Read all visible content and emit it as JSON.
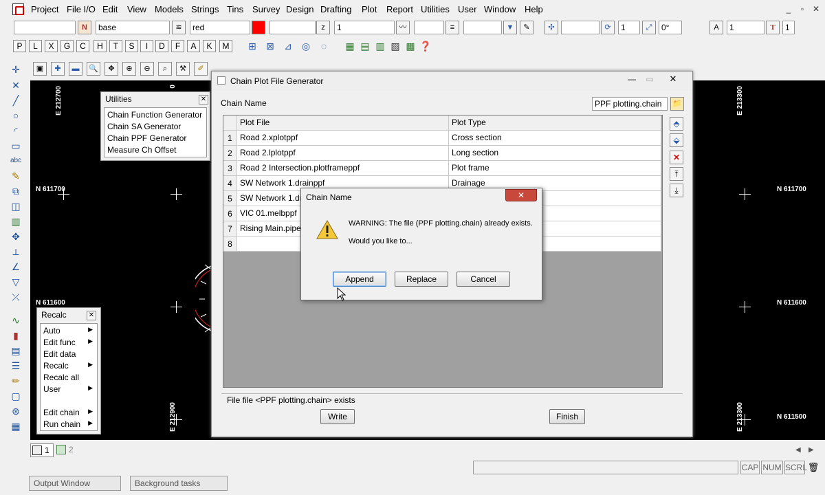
{
  "menu": [
    "Project",
    "File I/O",
    "Edit",
    "View",
    "Models",
    "Strings",
    "Tins",
    "Survey",
    "Design",
    "Drafting",
    "Plot",
    "Report",
    "Utilities",
    "User",
    "Window",
    "Help"
  ],
  "window_controls": {
    "minimize": "_",
    "restore": "▫",
    "close": "✕"
  },
  "toolbar": {
    "model": "base",
    "colour": "red",
    "colour_hex": "#ff0000",
    "weight": "1",
    "count": "1",
    "angle": "0°",
    "text_size": "1",
    "last": "1"
  },
  "letters": [
    "P",
    "L",
    "X",
    "G",
    "C",
    "H",
    "T",
    "S",
    "I",
    "D",
    "F",
    "A",
    "K",
    "M"
  ],
  "canvas": {
    "labels_vertical": [
      "E 212700",
      "0",
      "E 213300",
      "E 212900",
      "E 213300"
    ],
    "labels_northing": [
      "N 611700",
      "N 611700",
      "N 611600",
      "N 611600",
      "N 611500"
    ]
  },
  "utilities_panel": {
    "title": "Utilities",
    "items": [
      "Chain Function Generator",
      "Chain SA Generator",
      "Chain PPF Generator",
      "Measure Ch Offset"
    ]
  },
  "recalc_panel": {
    "title": "Recalc",
    "items": [
      {
        "label": "Auto",
        "arrow": "▶"
      },
      {
        "label": "Edit func",
        "arrow": "▶"
      },
      {
        "label": "Edit data",
        "arrow": ""
      },
      {
        "label": "Recalc",
        "arrow": "▶"
      },
      {
        "label": "Recalc all",
        "arrow": ""
      },
      {
        "label": "User",
        "arrow": "▶"
      },
      {
        "label": "Edit chain",
        "arrow": "▶"
      },
      {
        "label": "Run chain",
        "arrow": "▶"
      }
    ]
  },
  "dialog": {
    "title": "Chain Plot File Generator",
    "chain_name_label": "Chain Name",
    "chain_name_value": "PPF plotting.chain",
    "columns": [
      "Plot File",
      "Plot Type"
    ],
    "rows": [
      {
        "num": "1",
        "file": "Road 2.xplotppf",
        "type": "Cross section"
      },
      {
        "num": "2",
        "file": "Road 2.lplotppf",
        "type": "Long section"
      },
      {
        "num": "3",
        "file": "Road 2 Intersection.plotframeppf",
        "type": "Plot frame"
      },
      {
        "num": "4",
        "file": "SW Network 1.drainppf",
        "type": "Drainage"
      },
      {
        "num": "5",
        "file": "SW Network 1.dr",
        "type": ""
      },
      {
        "num": "6",
        "file": "VIC 01.melbppf",
        "type": ""
      },
      {
        "num": "7",
        "file": "Rising Main.pipel",
        "type": ""
      },
      {
        "num": "8",
        "file": "",
        "type": ""
      }
    ],
    "status": "File file <PPF plotting.chain> exists",
    "write_label": "Write",
    "finish_label": "Finish"
  },
  "warning": {
    "title": "Chain Name",
    "message": "WARNING: The file (PPF plotting.chain) already exists.",
    "question": "Would you like to...",
    "append_label": "Append",
    "replace_label": "Replace",
    "cancel_label": "Cancel"
  },
  "tabs": {
    "view1": "1",
    "view2": "2"
  },
  "status_bar": {
    "output_window": "Output Window",
    "background_tasks": "Background tasks",
    "cap": "CAP",
    "num": "NUM",
    "scrl": "SCRL"
  }
}
